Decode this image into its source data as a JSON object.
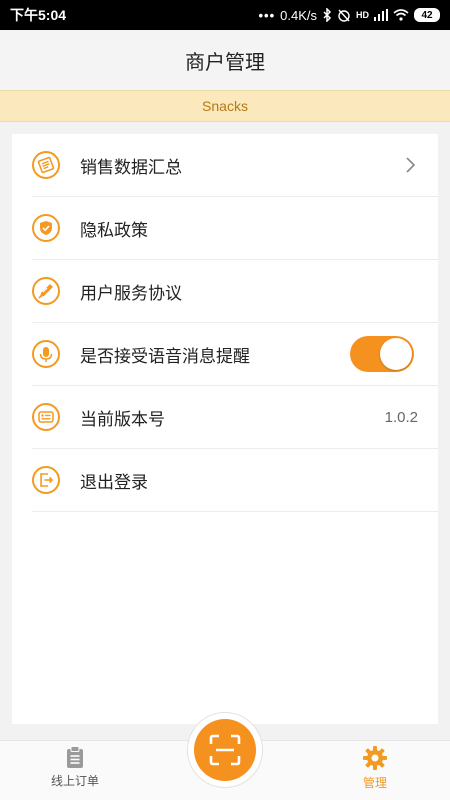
{
  "status_bar": {
    "time": "下午5:04",
    "network_speed": "0.4K/s",
    "battery": "42",
    "network_type": "HD"
  },
  "header": {
    "title": "商户管理"
  },
  "store": {
    "name": "Snacks"
  },
  "menu": {
    "items": [
      {
        "label": "销售数据汇总",
        "icon": "report-icon"
      },
      {
        "label": "隐私政策",
        "icon": "shield-check-icon"
      },
      {
        "label": "用户服务协议",
        "icon": "pen-icon"
      },
      {
        "label": "是否接受语音消息提醒",
        "icon": "microphone-icon"
      },
      {
        "label": "当前版本号",
        "icon": "version-icon"
      },
      {
        "label": "退出登录",
        "icon": "logout-icon"
      }
    ],
    "voice_reminder_enabled": true,
    "version": "1.0.2"
  },
  "bottom_nav": {
    "orders_label": "线上订单",
    "manage_label": "管理",
    "active_tab": "管理"
  },
  "colors": {
    "accent": "#f5911e",
    "banner_bg": "#fbe8bd",
    "banner_text": "#b47a14"
  }
}
